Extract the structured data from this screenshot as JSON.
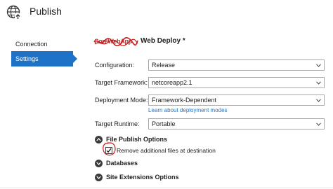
{
  "window": {
    "title": "Publish"
  },
  "nav": {
    "items": [
      {
        "label": "Connection",
        "active": false
      },
      {
        "label": "Settings",
        "active": true
      }
    ]
  },
  "header": {
    "redacted_name": "CoreWebApp",
    "title": "Web Deploy *"
  },
  "form": {
    "configuration": {
      "label": "Configuration:",
      "value": "Release"
    },
    "target_framework": {
      "label": "Target Framework:",
      "value": "netcoreapp2.1"
    },
    "deployment_mode": {
      "label": "Deployment Mode:",
      "value": "Framework-Dependent"
    },
    "deployment_link": "Learn about deployment modes",
    "target_runtime": {
      "label": "Target Runtime:",
      "value": "Portable"
    }
  },
  "sections": {
    "file_publish": {
      "label": "File Publish Options",
      "expanded": true
    },
    "remove_files": {
      "label": "Remove additional files at destination",
      "checked": true
    },
    "databases": {
      "label": "Databases",
      "expanded": false
    },
    "site_extensions": {
      "label": "Site Extensions Options",
      "expanded": false
    }
  },
  "colors": {
    "accent": "#1e73c8",
    "annotation": "#d01818"
  }
}
